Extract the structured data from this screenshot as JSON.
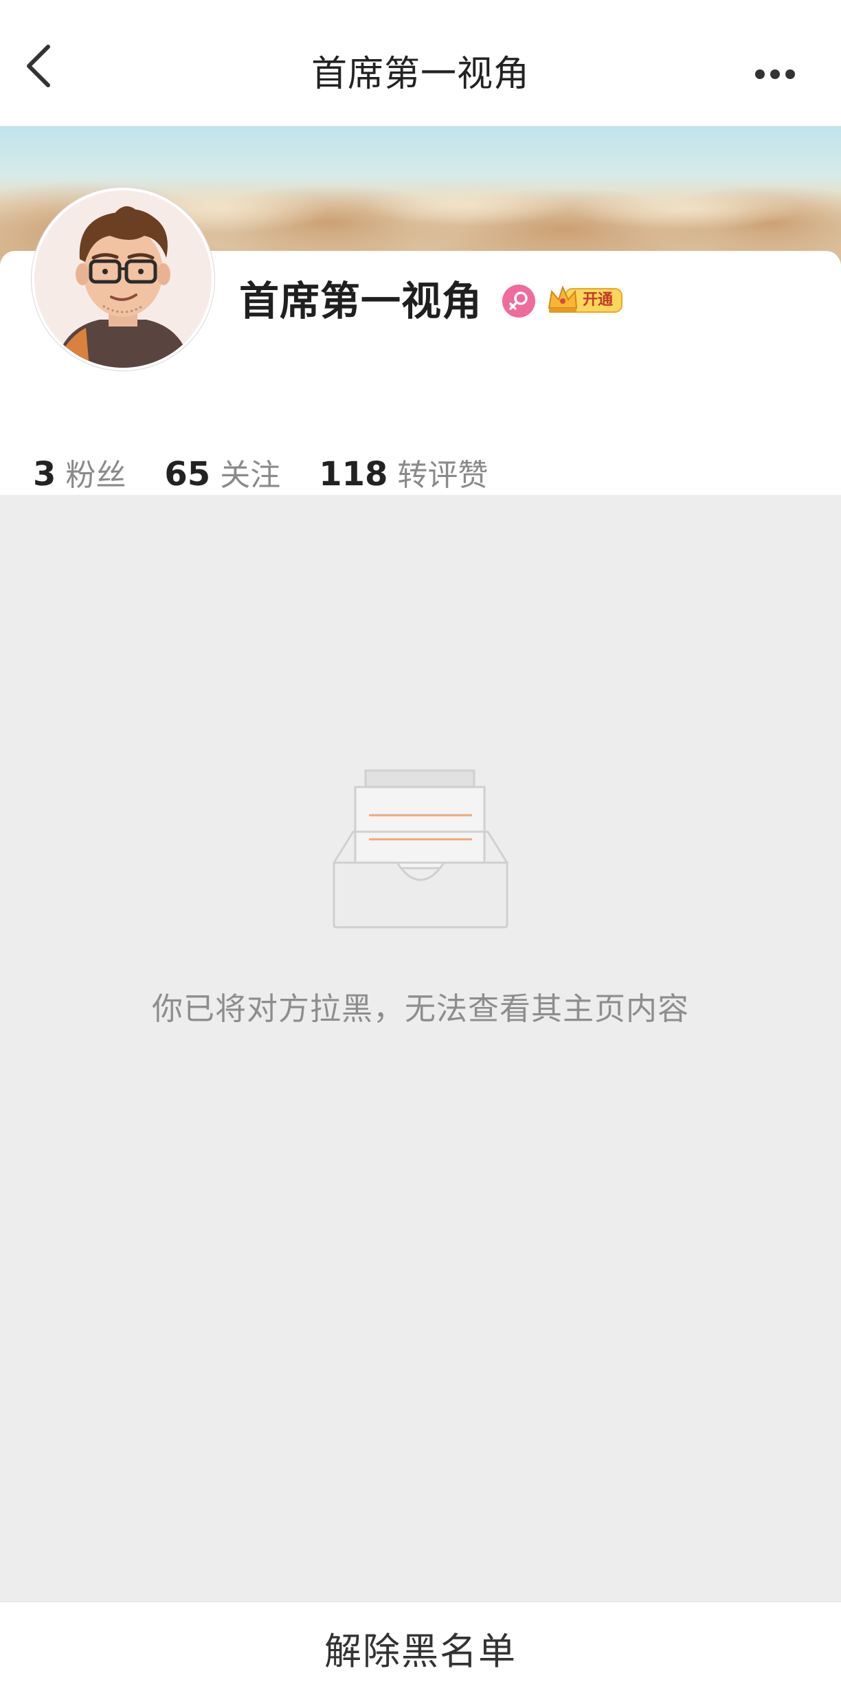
{
  "nav": {
    "title": "首席第一视角",
    "back_icon": "chevron-left-icon",
    "more_icon": "more-horizontal-icon"
  },
  "profile": {
    "name": "首席第一视角",
    "gender_icon": "female-gender-icon",
    "vip_label": "开通",
    "stats": [
      {
        "value": "3",
        "label": "粉丝"
      },
      {
        "value": "65",
        "label": "关注"
      },
      {
        "value": "118",
        "label": "转评赞"
      }
    ]
  },
  "empty_state": {
    "illustration_icon": "empty-inbox-icon",
    "message": "你已将对方拉黑，无法查看其主页内容"
  },
  "bottom": {
    "unblock_label": "解除黑名单"
  },
  "colors": {
    "background": "#ededed",
    "card": "#ffffff",
    "accent_pink": "#f06a9c",
    "vip_gold": "#f7c843"
  }
}
